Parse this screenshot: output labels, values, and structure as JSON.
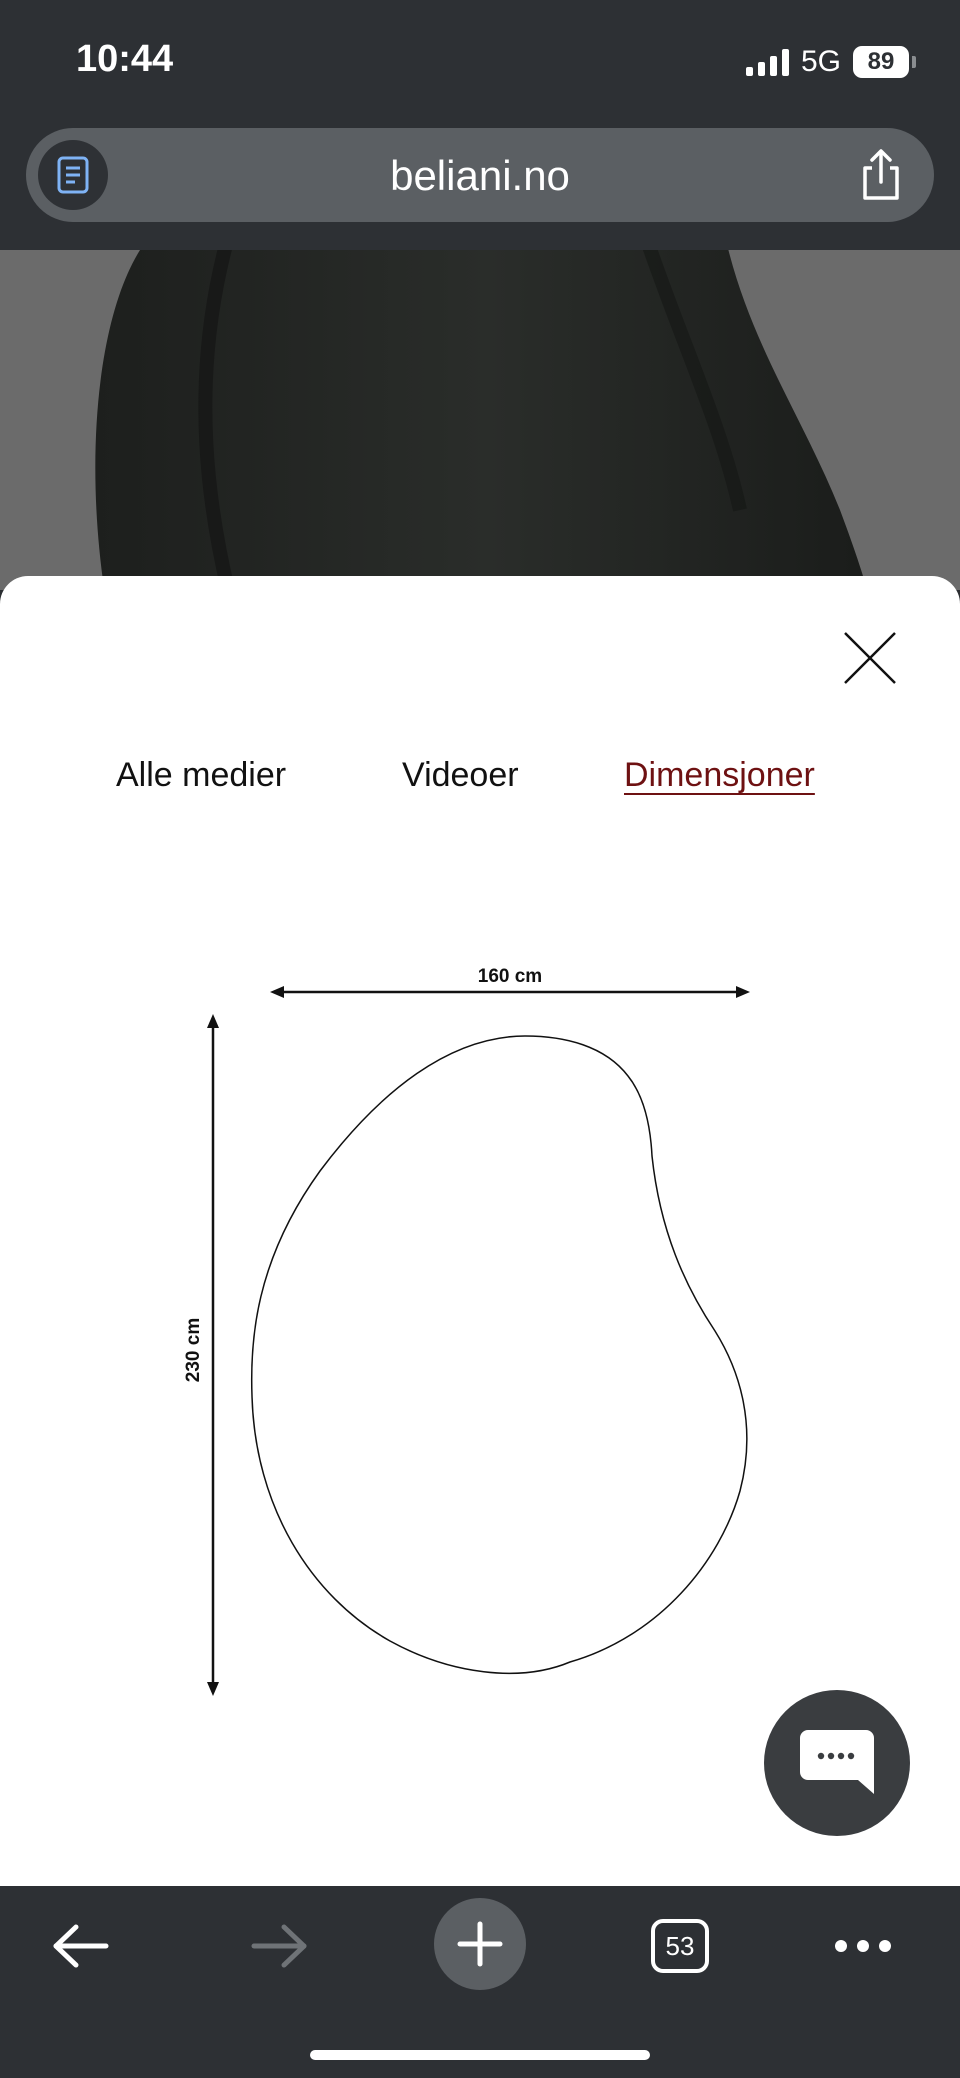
{
  "status_bar": {
    "time": "10:44",
    "network": "5G",
    "battery": "89"
  },
  "browser": {
    "url": "beliani.no",
    "tab_count": "53"
  },
  "modal": {
    "tabs": [
      {
        "label": "Alle medier",
        "active": false
      },
      {
        "label": "Videoer",
        "active": false
      },
      {
        "label": "Dimensjoner",
        "active": true
      }
    ],
    "active_tab_color": "#6e1112",
    "dimensions": {
      "width_label": "160 cm",
      "height_label": "230 cm"
    }
  },
  "icons": {
    "reader": "reader-mode-icon",
    "share": "share-icon",
    "close": "close-icon",
    "chat": "chat-icon",
    "back": "back-arrow-icon",
    "forward": "forward-arrow-icon",
    "new_tab": "plus-icon",
    "tabs": "tab-switcher-icon",
    "more": "more-dots-icon"
  }
}
